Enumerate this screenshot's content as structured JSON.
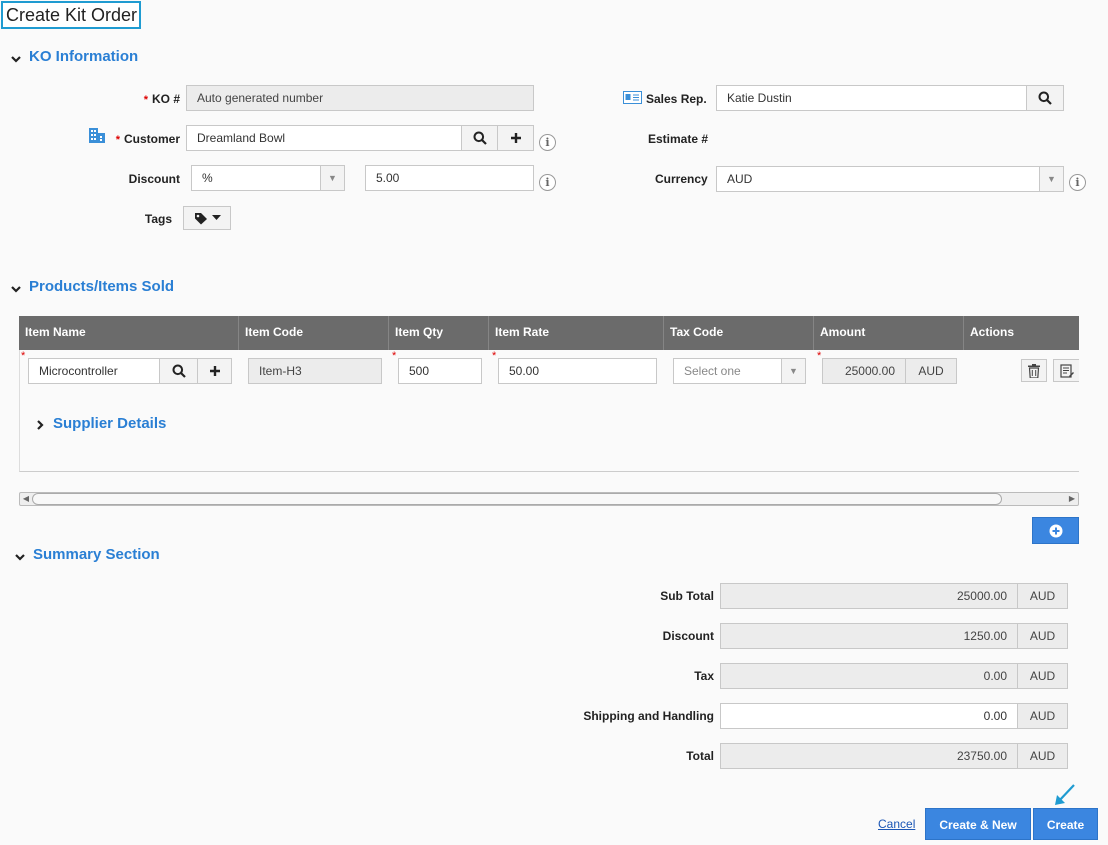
{
  "page": {
    "title": "Create Kit Order"
  },
  "ko_info": {
    "section_title": "KO Information",
    "ko_label": "KO #",
    "ko_value": "Auto generated number",
    "sales_rep_label": "Sales Rep.",
    "sales_rep_value": "Katie Dustin",
    "customer_label": "Customer",
    "customer_value": "Dreamland Bowl",
    "estimate_label": "Estimate #",
    "discount_label": "Discount",
    "discount_type": "%",
    "discount_value": "5.00",
    "currency_label": "Currency",
    "currency_value": "AUD",
    "tags_label": "Tags",
    "info_glyph": "i",
    "required_mark": "*"
  },
  "products": {
    "section_title": "Products/Items Sold",
    "columns": [
      "Item Name",
      "Item Code",
      "Item Qty",
      "Item Rate",
      "Tax Code",
      "Amount",
      "Actions"
    ],
    "row": {
      "item_name": "Microcontroller",
      "item_code": "Item-H3",
      "qty": "500",
      "rate": "50.00",
      "tax_placeholder": "Select one",
      "amount": "25000.00",
      "amount_currency": "AUD"
    },
    "supplier_details_label": "Supplier Details"
  },
  "summary": {
    "section_title": "Summary Section",
    "rows": [
      {
        "label": "Sub Total",
        "value": "25000.00",
        "currency": "AUD"
      },
      {
        "label": "Discount",
        "value": "1250.00",
        "currency": "AUD"
      },
      {
        "label": "Tax",
        "value": "0.00",
        "currency": "AUD"
      },
      {
        "label": "Shipping and Handling",
        "value": "0.00",
        "currency": "AUD"
      },
      {
        "label": "Total",
        "value": "23750.00",
        "currency": "AUD"
      }
    ]
  },
  "footer": {
    "cancel_label": "Cancel",
    "create_new_label": "Create & New",
    "create_label": "Create"
  },
  "colors": {
    "accent": "#2a7fd4",
    "primary_button": "#3b86e0",
    "grid_header": "#6b6b6b",
    "title_border": "#1f9bd1",
    "required": "#dd0000"
  },
  "icons": [
    "chevron-down-icon",
    "chevron-right-icon",
    "contact-card-icon",
    "building-icon",
    "search-icon",
    "plus-icon",
    "info-icon",
    "tag-icon",
    "caret-down-icon",
    "trash-icon",
    "edit-icon",
    "plus-circle-icon",
    "pointer-arrow-icon"
  ]
}
